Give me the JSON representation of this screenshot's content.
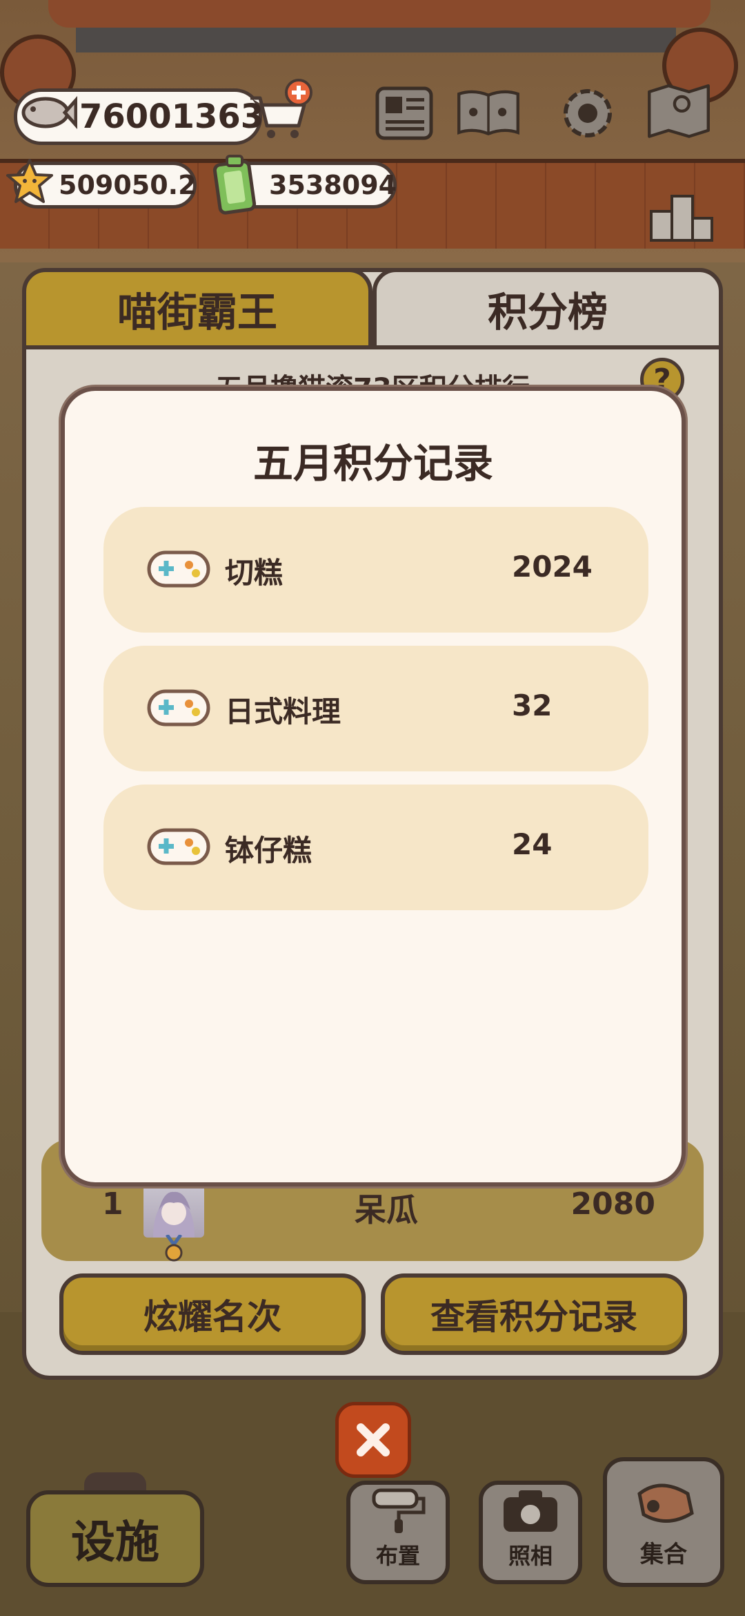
{
  "hud": {
    "fish_count": "76001363",
    "star_count": "509050.2",
    "ticket_count": "3538094",
    "icons": [
      "fish-icon",
      "cart-plus-icon",
      "star-icon",
      "ticket-icon",
      "newspaper-icon",
      "paw-book-icon",
      "gear-icon",
      "map-icon",
      "podium-icon"
    ]
  },
  "tabs": [
    {
      "label": "喵街霸王",
      "active": false
    },
    {
      "label": "积分榜",
      "active": true
    }
  ],
  "panel": {
    "subtitle": "五月撸猫滚73区积分排行",
    "help_label": "?",
    "rank_row": {
      "rank": "1",
      "name": "呆瓜",
      "score": "2080"
    },
    "show_rank_label": "炫耀名次",
    "view_records_label": "查看积分记录"
  },
  "modal": {
    "title": "五月积分记录",
    "records": [
      {
        "icon": "gamepad-icon",
        "name": "切糕",
        "score": "2024"
      },
      {
        "icon": "gamepad-icon",
        "name": "日式料理",
        "score": "32"
      },
      {
        "icon": "gamepad-icon",
        "name": "钵仔糕",
        "score": "24"
      }
    ]
  },
  "bottom_bar": {
    "settings_label": "设施",
    "layout_label": "布置",
    "photo_label": "照相",
    "rally_label": "集合"
  },
  "colors": {
    "accent_gold": "#b8952e",
    "outline_brown": "#4a3a33",
    "modal_bg": "#fdf6ee",
    "record_bg": "#f6e6c8",
    "close_red": "#c24a1e"
  }
}
